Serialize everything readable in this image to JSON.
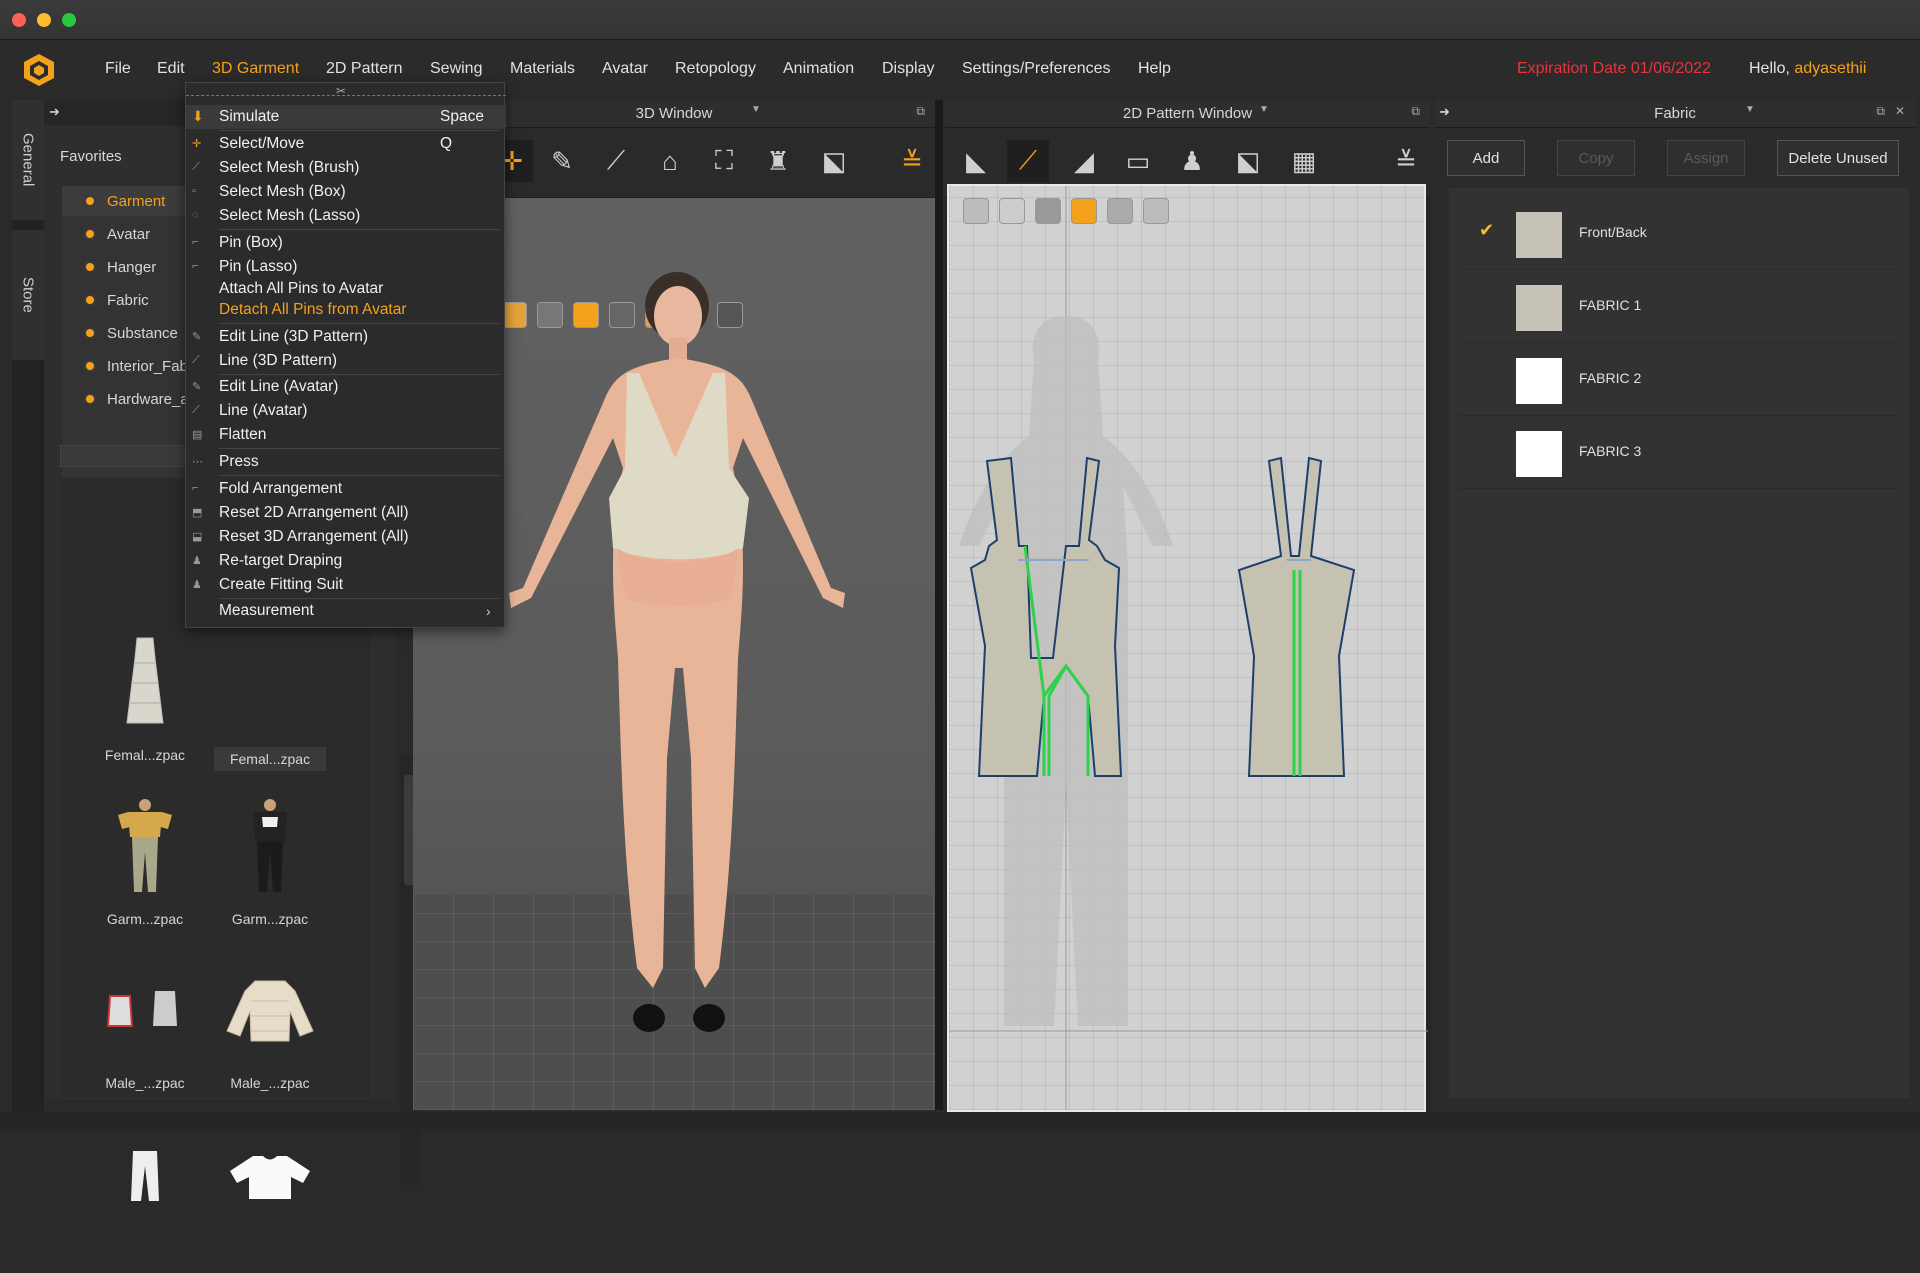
{
  "menubar": {
    "items": [
      "File",
      "Edit",
      "3D Garment",
      "2D Pattern",
      "Sewing",
      "Materials",
      "Avatar",
      "Retopology",
      "Animation",
      "Display",
      "Settings/Preferences",
      "Help"
    ],
    "active": "3D Garment",
    "expiration": "Expiration Date 01/06/2022",
    "hello_prefix": "Hello,",
    "username": "adyasethii"
  },
  "sidetabs": [
    "General",
    "Store"
  ],
  "left_panel": {
    "favorites_title": "Favorites",
    "favorites": [
      "Garment",
      "Avatar",
      "Hanger",
      "Fabric",
      "Substance",
      "Interior_Fab",
      "Hardware_a"
    ],
    "thumbnails": [
      "Femal...zpac",
      "Femal...zpac",
      "Garm...zpac",
      "Garm...zpac",
      "Male_...zpac",
      "Male_...zpac",
      "",
      ""
    ]
  },
  "window3d": {
    "title": "3D Window"
  },
  "window2d": {
    "title": "2D Pattern Window"
  },
  "fabric_panel": {
    "title": "Fabric",
    "buttons": {
      "add": "Add",
      "copy": "Copy",
      "assign": "Assign",
      "delete_unused": "Delete Unused"
    },
    "fabrics": [
      {
        "name": "Front/Back",
        "color": "#c7c2b8",
        "checked": true
      },
      {
        "name": "FABRIC 1",
        "color": "#c7c2b8",
        "checked": false
      },
      {
        "name": "FABRIC 2",
        "color": "#ffffff",
        "checked": false
      },
      {
        "name": "FABRIC 3",
        "color": "#ffffff",
        "checked": false
      }
    ]
  },
  "dropdown": {
    "items": [
      {
        "label": "Simulate",
        "shortcut": "Space",
        "icon": "simulate-icon"
      },
      {
        "label": "Select/Move",
        "shortcut": "Q",
        "icon": "select-move-icon"
      },
      {
        "label": "Select Mesh (Brush)",
        "icon": "select-mesh-brush-icon"
      },
      {
        "label": "Select Mesh (Box)",
        "icon": "select-mesh-box-icon"
      },
      {
        "label": "Select Mesh (Lasso)",
        "icon": "select-mesh-lasso-icon"
      },
      {
        "label": "Pin (Box)",
        "icon": "pin-box-icon"
      },
      {
        "label": "Pin (Lasso)",
        "icon": "pin-lasso-icon"
      },
      {
        "label": "Attach All Pins to Avatar",
        "icon": ""
      },
      {
        "label": "Detach All Pins from Avatar",
        "icon": "",
        "highlight": true
      },
      {
        "label": "Edit Line (3D Pattern)",
        "icon": "edit-line-3d-icon"
      },
      {
        "label": "Line (3D Pattern)",
        "icon": "line-3d-icon"
      },
      {
        "label": "Edit Line (Avatar)",
        "icon": "edit-line-avatar-icon"
      },
      {
        "label": "Line (Avatar)",
        "icon": "line-avatar-icon"
      },
      {
        "label": "Flatten",
        "icon": "flatten-icon"
      },
      {
        "label": "Press",
        "icon": "press-icon"
      },
      {
        "label": "Fold Arrangement",
        "icon": "fold-arrangement-icon"
      },
      {
        "label": "Reset 2D Arrangement (All)",
        "icon": "reset-2d-icon"
      },
      {
        "label": "Reset 3D Arrangement (All)",
        "icon": "reset-3d-icon"
      },
      {
        "label": "Re-target Draping",
        "icon": "retarget-draping-icon"
      },
      {
        "label": "Create Fitting Suit",
        "icon": "fitting-suit-icon"
      },
      {
        "label": "Measurement",
        "icon": "",
        "submenu": true
      }
    ]
  },
  "colors": {
    "accent": "#f4a11b",
    "expire": "#e8343f",
    "pattern_fill": "#c7c3b3",
    "seam": "#2fd14a"
  }
}
